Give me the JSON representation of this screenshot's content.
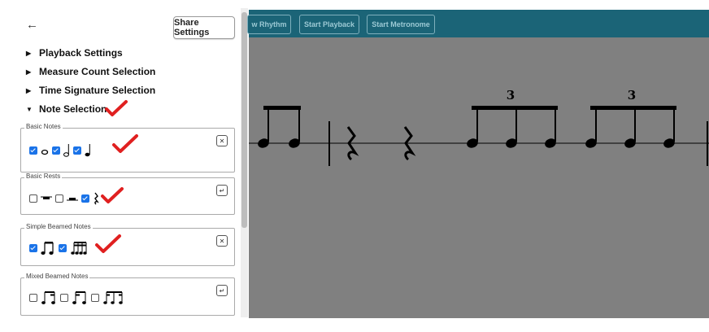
{
  "toolbar": {
    "buttons": [
      {
        "label": "w Rhythm"
      },
      {
        "label": "Start Playback"
      },
      {
        "label": "Start Metronome"
      }
    ],
    "color": "#1b6477"
  },
  "panel": {
    "back_icon": "arrow-left",
    "share_label": "Share Settings",
    "sections": [
      {
        "label": "Playback Settings",
        "expanded": false
      },
      {
        "label": "Measure Count Selection",
        "expanded": false
      },
      {
        "label": "Time Signature Selection",
        "expanded": false
      },
      {
        "label": "Note Selection",
        "expanded": true
      }
    ],
    "groups": [
      {
        "title": "Basic Notes",
        "button_icon": "close-x"
      },
      {
        "title": "Basic Rests",
        "button_icon": "check-arrow"
      },
      {
        "title": "Simple Beamed Notes",
        "button_icon": "close-x"
      },
      {
        "title": "Mixed Beamed Notes",
        "button_icon": "check-arrow"
      }
    ]
  },
  "score": {
    "tuplet_labels": [
      "3",
      "3"
    ]
  },
  "colors": {
    "annotation_red": "#e02020",
    "stage_gray": "#808080",
    "checkbox_blue": "#1a73e8"
  }
}
